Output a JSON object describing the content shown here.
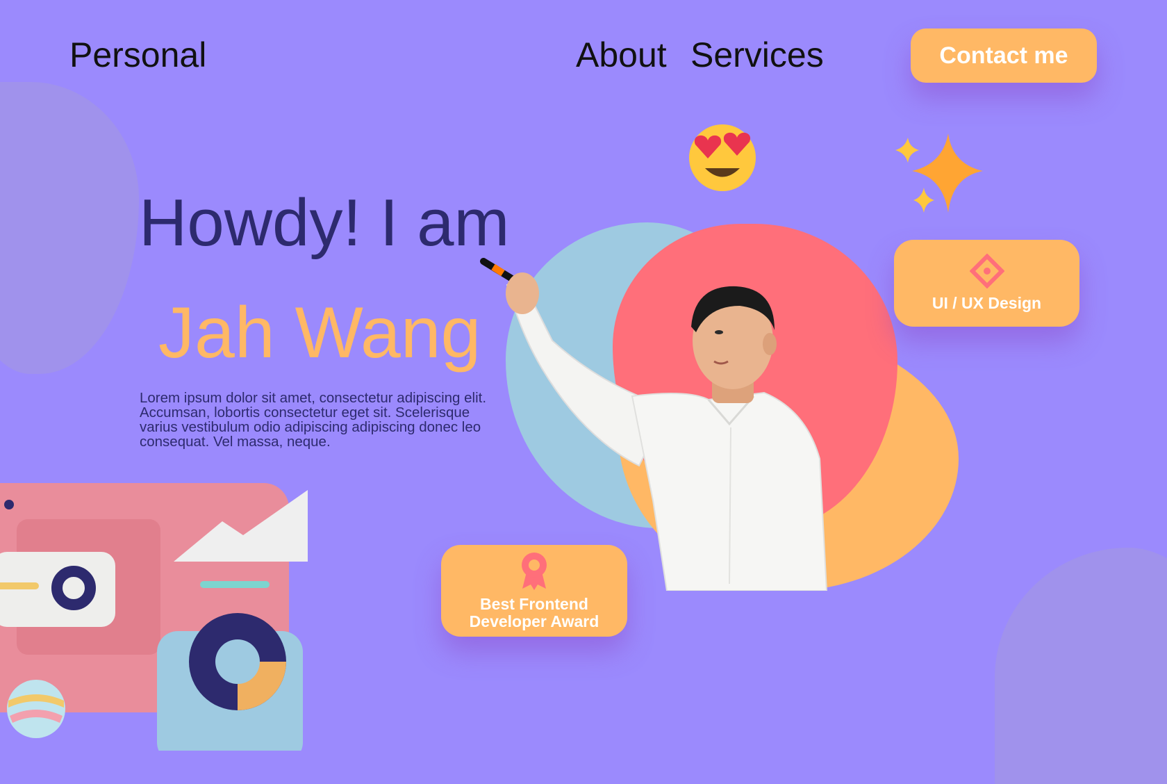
{
  "nav": {
    "brand": "Personal",
    "about": "About",
    "services": "Services",
    "contact": "Contact me"
  },
  "hero": {
    "greeting": "Howdy! I am",
    "name": "Jah Wang",
    "description": "Lorem ipsum dolor sit amet, consectetur adipiscing elit. Accumsan, lobortis consectetur eget sit. Scelerisque varius vestibulum odio adipiscing adipiscing donec leo consequat. Vel massa, neque."
  },
  "cards": {
    "uiux": {
      "label": "UI / UX Design",
      "icon": "diamond-icon"
    },
    "award": {
      "line1": "Best Frontend",
      "line2": "Developer Award",
      "icon": "award-ribbon-icon"
    }
  },
  "colors": {
    "background": "#9b8afd",
    "accent": "#ffb865",
    "heading": "#2d2a6e",
    "pink": "#ff6f7a",
    "blue": "#9ecae1"
  }
}
